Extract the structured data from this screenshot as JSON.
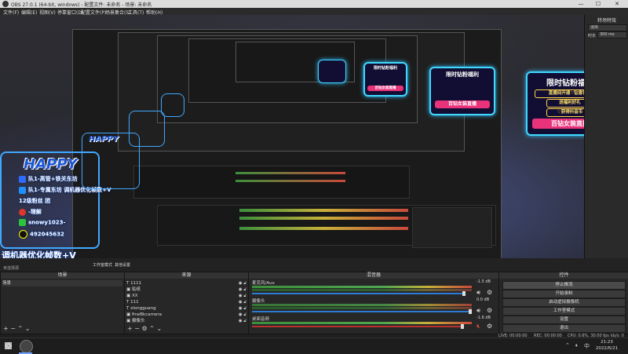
{
  "window": {
    "title": "OBS 27.0.1 (64-bit, windows) - 配置文件: 未命名 - 场景: 未命名",
    "min_glyph": "—",
    "max_glyph": "☐",
    "close_glyph": "✕"
  },
  "menu": [
    "文件(F)",
    "编辑(E)",
    "视图(V)",
    "停靠窗口(D)",
    "配置文件(P)",
    "场景集合(S)",
    "工具(T)",
    "帮助(H)"
  ],
  "preview": {
    "promo": {
      "title": "限时钻粉福利",
      "line1": "直播间开通♡钻香钻粉",
      "line2": "送福利好礼",
      "line3": "♡获得抖音币",
      "button": "百钻女装直播"
    },
    "overlay": {
      "logo": "HAPPY",
      "lines": [
        "队1-高管+铁关东坊",
        "队1-专属东坊  调机器优化帧数+V",
        "12级粉丝  团",
        "-理解",
        "snowy1023-",
        "492045632"
      ],
      "big": "调机器优化帧数+V"
    }
  },
  "transition_panel": {
    "title": "转场特效",
    "selected": "淡出",
    "duration_label": "时长",
    "duration_value": "300 ms"
  },
  "mid_strip": {
    "studio_label": "工作室模式",
    "other_label": "其他设置",
    "not_selected": "未选择源"
  },
  "docks": {
    "scenes": {
      "title": "场景",
      "items": [
        "场景"
      ]
    },
    "sources": {
      "title": "来源",
      "items": [
        {
          "icon": "text-icon",
          "label": "1111"
        },
        {
          "icon": "image-icon",
          "label": "贴纸"
        },
        {
          "icon": "image-icon",
          "label": "XX"
        },
        {
          "icon": "text-icon",
          "label": "111"
        },
        {
          "icon": "text-icon",
          "label": "xlongguang"
        },
        {
          "icon": "image-icon",
          "label": "fineBkcamera"
        },
        {
          "icon": "image-icon",
          "label": "摄像头"
        }
      ]
    },
    "mixer": {
      "title": "混音器",
      "channels": [
        {
          "name": "麦克风/Aux",
          "db": "-1.5 dB",
          "level": 0.88,
          "muted": false
        },
        {
          "name": "摄像头",
          "db": "0.0 dB",
          "level": 0.72,
          "muted": false
        },
        {
          "name": "桌面音频",
          "db": "-1.6 dB",
          "level": 0.86,
          "muted": true
        }
      ]
    },
    "controls": {
      "title": "控件",
      "buttons": [
        "停止推流",
        "开始录制",
        "启动虚拟摄像机",
        "工作室模式",
        "设置",
        "退出"
      ]
    }
  },
  "statusbar": {
    "dropped": "LIVE: 00:00:00",
    "rec": "REC: 00:00:00",
    "cpu": "CPU: 0.6%, 30.00 fps",
    "kbps": "kb/s: 0"
  },
  "taskbar": {
    "time": "21:23",
    "date": "2022/6/21"
  },
  "colors": {
    "accent": "#3fd8ff",
    "promo_pink": "#e8327a",
    "promo_gold": "#ffd34d",
    "overlay_blue": "#41a8ff"
  }
}
